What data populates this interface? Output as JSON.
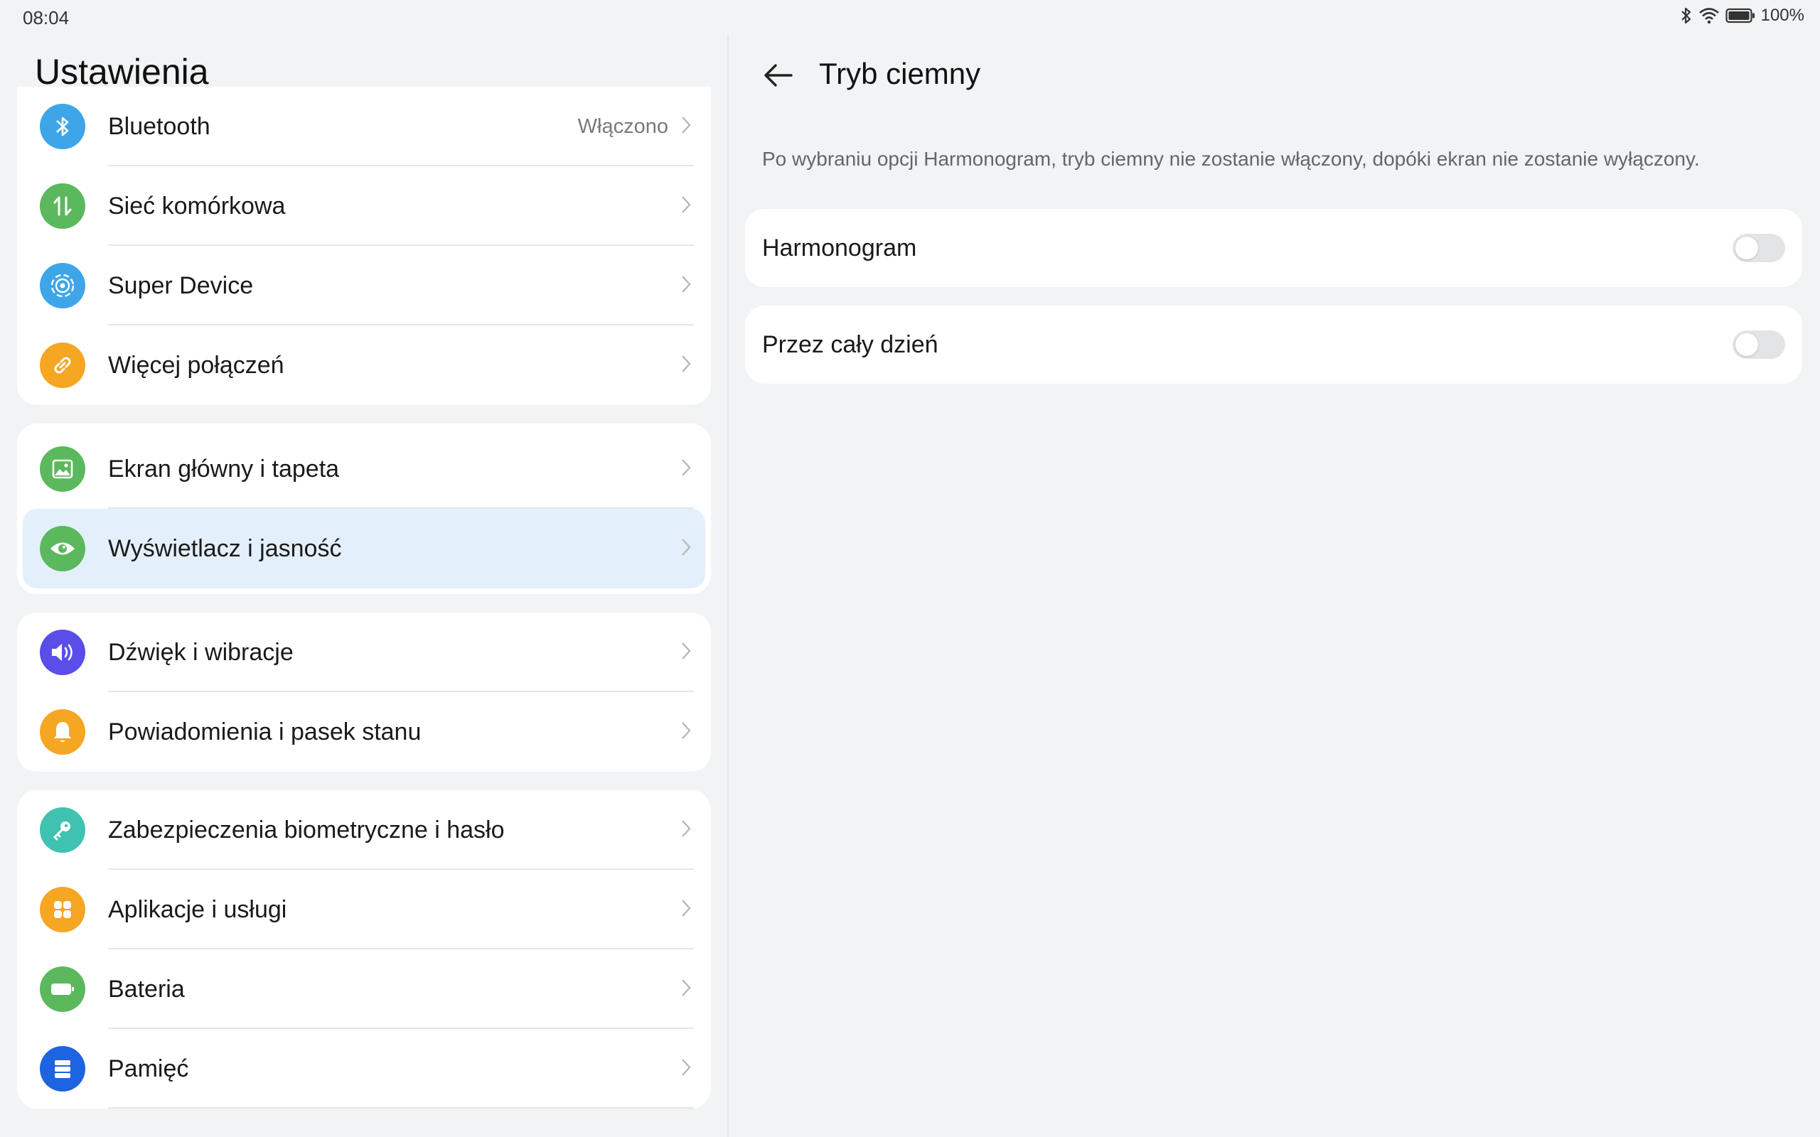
{
  "status": {
    "time": "08:04",
    "battery": "100%"
  },
  "left": {
    "title": "Ustawienia",
    "groups": [
      {
        "items": [
          {
            "label": "Bluetooth",
            "value": "Włączono",
            "icon": "bluetooth-icon",
            "color": "#3ea6e8"
          },
          {
            "label": "Sieć komórkowa",
            "icon": "cellular-data-icon",
            "color": "#5cb85c"
          },
          {
            "label": "Super Device",
            "icon": "super-device-icon",
            "color": "#3ea6e8"
          },
          {
            "label": "Więcej połączeń",
            "icon": "link-icon",
            "color": "#f5a623"
          }
        ]
      },
      {
        "items": [
          {
            "label": "Ekran główny i tapeta",
            "icon": "image-icon",
            "color": "#5cb85c"
          },
          {
            "label": "Wyświetlacz i jasność",
            "icon": "eye-icon",
            "color": "#5cb85c"
          }
        ]
      },
      {
        "items": [
          {
            "label": "Dźwięk i wibracje",
            "icon": "speaker-icon",
            "color": "#5b4de8"
          },
          {
            "label": "Powiadomienia i pasek stanu",
            "icon": "bell-icon",
            "color": "#f5a623"
          }
        ]
      },
      {
        "items": [
          {
            "label": "Zabezpieczenia biometryczne i hasło",
            "icon": "key-icon",
            "color": "#3fc2b0"
          },
          {
            "label": "Aplikacje i usługi",
            "icon": "apps-icon",
            "color": "#f5a623"
          },
          {
            "label": "Bateria",
            "icon": "battery-icon",
            "color": "#5cb85c"
          },
          {
            "label": "Pamięć",
            "icon": "storage-icon",
            "color": "#1e63e0"
          }
        ]
      }
    ]
  },
  "right": {
    "title": "Tryb ciemny",
    "description": "Po wybraniu opcji Harmonogram, tryb ciemny nie zostanie włączony, dopóki ekran nie zostanie wyłączony.",
    "options": [
      {
        "label": "Harmonogram",
        "enabled": false
      },
      {
        "label": "Przez cały dzień",
        "enabled": false
      }
    ]
  },
  "colors": {
    "background": "#f1f3f5",
    "active_row": "#e3f0fc"
  }
}
